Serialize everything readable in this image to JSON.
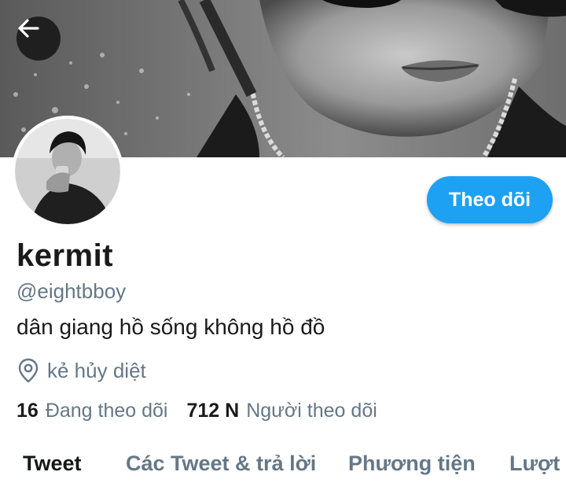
{
  "header": {
    "back_icon": "arrow-left-icon"
  },
  "profile": {
    "name": "kermit",
    "handle": "@eightbboy",
    "bio": "dân giang hồ sống không hồ đồ",
    "location_icon": "location-pin-icon",
    "location": "kẻ hủy diệt",
    "following_count": "16",
    "following_label": "Đang theo dõi",
    "followers_count": "712 N",
    "followers_label": "Người theo dõi"
  },
  "actions": {
    "follow_label": "Theo dõi"
  },
  "tabs": [
    {
      "label": "Tweet",
      "active": true
    },
    {
      "label": "Các Tweet & trả lời",
      "active": false
    },
    {
      "label": "Phương tiện",
      "active": false
    },
    {
      "label": "Lượt thích",
      "active": false
    }
  ],
  "colors": {
    "accent": "#1da1f2",
    "muted_text": "#657786",
    "primary_text": "#14171a"
  }
}
